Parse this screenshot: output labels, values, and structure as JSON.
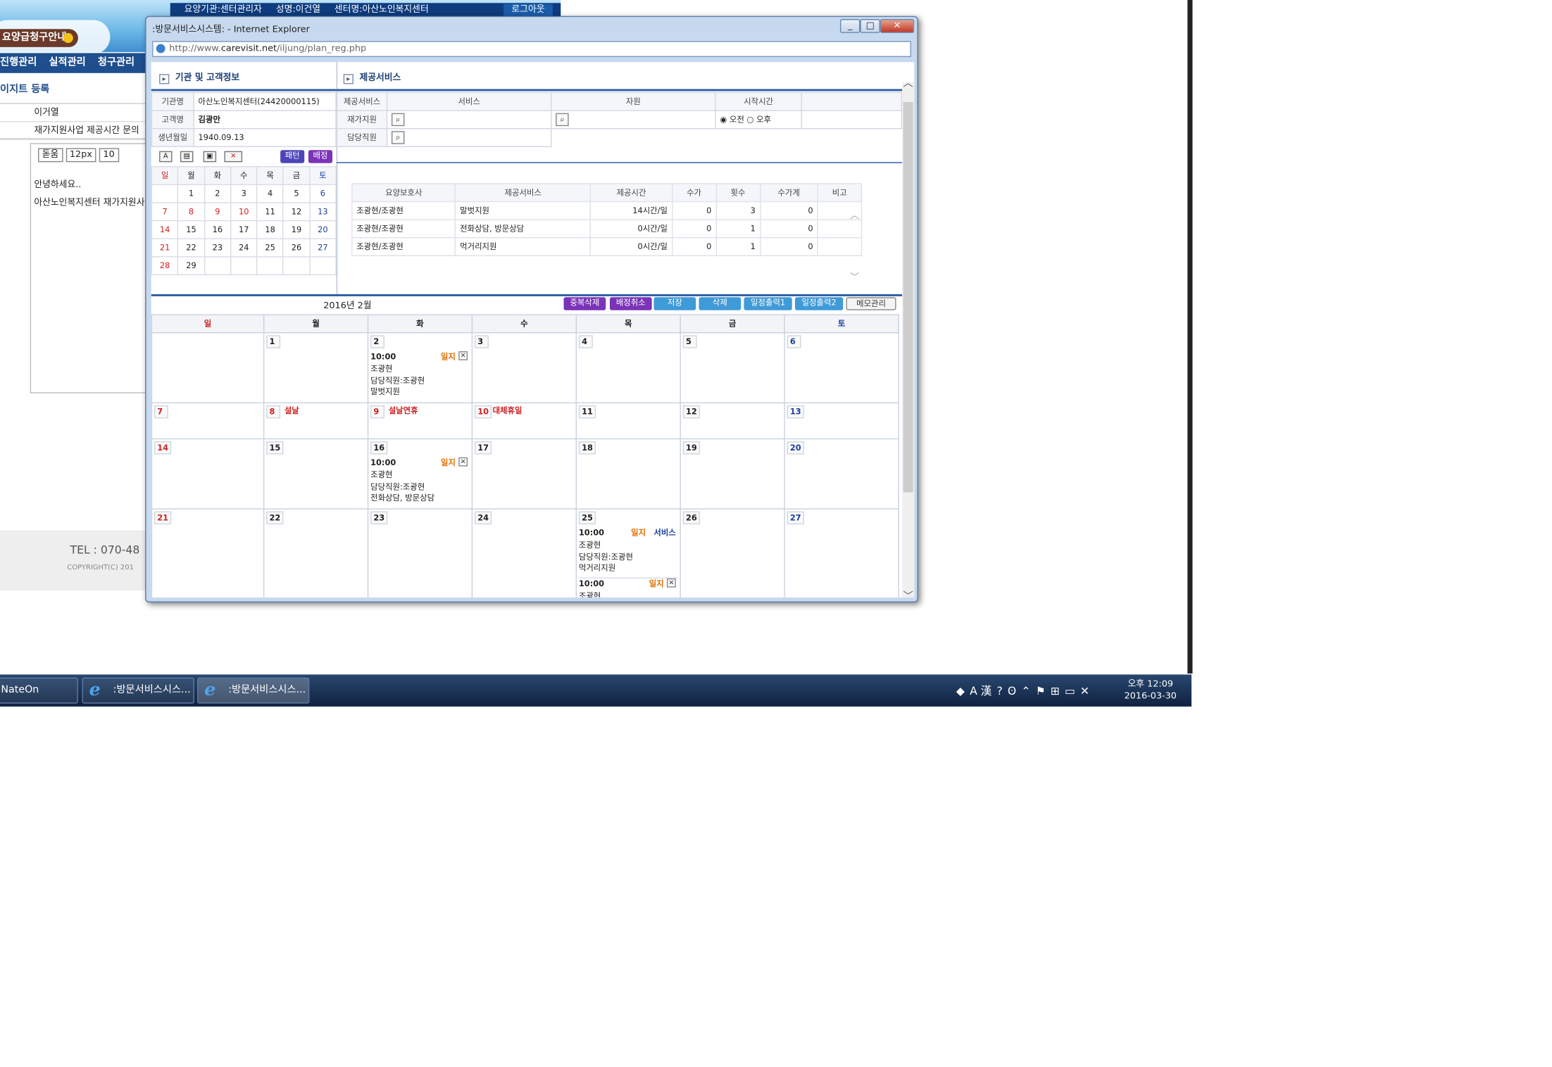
{
  "bg": {
    "notice": "요양급청구안내",
    "nav": [
      "진행관리",
      "실적관리",
      "청구관리"
    ],
    "heading": "이지트 등록",
    "info_rows": [
      "이거열",
      "재가지원사업 제공시간 문의"
    ],
    "selects": [
      "돋움",
      "12px",
      "10"
    ],
    "body_lines": [
      "안녕하세요..",
      "아산노인복지센터 재가지원사"
    ],
    "tel": "TEL : 070-48",
    "copyright": "COPYRIGHT(C) 201",
    "login_strip": [
      "요양기관:센터관리자",
      "성명:이건열",
      "센터명:아산노인복지센터"
    ],
    "logout": "로그아웃"
  },
  "window": {
    "title": ":방문서비스시스템: - Internet Explorer",
    "url_prefix": "http://www.",
    "url_domain": "carevisit.net",
    "url_path": "/iljung/plan_reg.php"
  },
  "left": {
    "title": "기관 및 고객정보",
    "rows": [
      {
        "label": "기관명",
        "value": "아산노인복지센터(24420000115)"
      },
      {
        "label": "고객명",
        "value": "김광만"
      },
      {
        "label": "생년월일",
        "value": "1940.09.13"
      }
    ],
    "tool_icons": [
      "font-icon",
      "table-icon",
      "print-icon",
      "delete-icon"
    ],
    "btn_pattern": "패턴",
    "btn_assign": "배정",
    "weekdays": [
      "일",
      "월",
      "화",
      "수",
      "목",
      "금",
      "토"
    ],
    "weeks": [
      [
        "",
        "1",
        "2",
        "3",
        "4",
        "5",
        "6"
      ],
      [
        "7",
        "8",
        "9",
        "10",
        "11",
        "12",
        "13"
      ],
      [
        "14",
        "15",
        "16",
        "17",
        "18",
        "19",
        "20"
      ],
      [
        "21",
        "22",
        "23",
        "24",
        "25",
        "26",
        "27"
      ],
      [
        "28",
        "29",
        "",
        "",
        "",
        "",
        ""
      ]
    ]
  },
  "services": {
    "title": "제공서비스",
    "cols": [
      "서비스",
      "자원",
      "시작시간"
    ],
    "rows": [
      {
        "label": "제공서비스"
      },
      {
        "label": "재가지원"
      },
      {
        "label": "담당직원"
      }
    ],
    "am": "오전",
    "pm": "오후",
    "table_headers": [
      "요양보호사",
      "제공서비스",
      "제공시간",
      "수가",
      "횟수",
      "수가계",
      "비고"
    ],
    "table_rows": [
      [
        "조광현/조광현",
        "말벗지원",
        "14시간/일",
        "0",
        "3",
        "0",
        ""
      ],
      [
        "조광현/조광현",
        "전화상담, 방문상담",
        "0시간/일",
        "0",
        "1",
        "0",
        ""
      ],
      [
        "조광현/조광현",
        "먹거리지원",
        "0시간/일",
        "0",
        "1",
        "0",
        ""
      ]
    ]
  },
  "actions": {
    "month": "2016년 2월",
    "buttons": [
      "중복삭제",
      "배정취소",
      "저장",
      "삭제",
      "일정출력1",
      "일정출력2",
      "메모관리"
    ]
  },
  "calendar": {
    "weekdays": [
      "일",
      "월",
      "화",
      "수",
      "목",
      "금",
      "토"
    ],
    "weeks": [
      [
        {
          "d": ""
        },
        {
          "d": "1"
        },
        {
          "d": "2",
          "ev": [
            {
              "time": "10:00",
              "il": "일지",
              "lines": [
                "조광현",
                "담당직원:조광현",
                "말벗지원"
              ]
            }
          ]
        },
        {
          "d": "3"
        },
        {
          "d": "4"
        },
        {
          "d": "5"
        },
        {
          "d": "6"
        }
      ],
      [
        {
          "d": "7"
        },
        {
          "d": "8",
          "hol": "설날"
        },
        {
          "d": "9",
          "hol": "설날연휴"
        },
        {
          "d": "10",
          "hol": "대체휴일"
        },
        {
          "d": "11"
        },
        {
          "d": "12"
        },
        {
          "d": "13"
        }
      ],
      [
        {
          "d": "14"
        },
        {
          "d": "15"
        },
        {
          "d": "16",
          "ev": [
            {
              "time": "10:00",
              "il": "일지",
              "lines": [
                "조광현",
                "담당직원:조광현",
                "전화상담, 방문상담"
              ]
            }
          ]
        },
        {
          "d": "17"
        },
        {
          "d": "18"
        },
        {
          "d": "19"
        },
        {
          "d": "20"
        }
      ],
      [
        {
          "d": "21"
        },
        {
          "d": "22"
        },
        {
          "d": "23"
        },
        {
          "d": "24"
        },
        {
          "d": "25",
          "ev": [
            {
              "time": "10:00",
              "il": "일지",
              "svc": "서비스",
              "lines": [
                "조광현",
                "담당직원:조광현",
                "먹거리지원"
              ]
            },
            {
              "time": "10:00",
              "il": "일지",
              "lines": [
                "조광현"
              ]
            }
          ]
        },
        {
          "d": "26"
        },
        {
          "d": "27"
        }
      ]
    ]
  },
  "taskbar": {
    "items": [
      "NateOn",
      ":방문서비스시스...",
      ":방문서비스시스..."
    ],
    "ime": "A 漢",
    "time": "오후 12:09",
    "date": "2016-03-30"
  },
  "colors": {
    "purple": "#7b33b8",
    "blue": "#3f9ad8",
    "accent": "#2a5aa3"
  }
}
